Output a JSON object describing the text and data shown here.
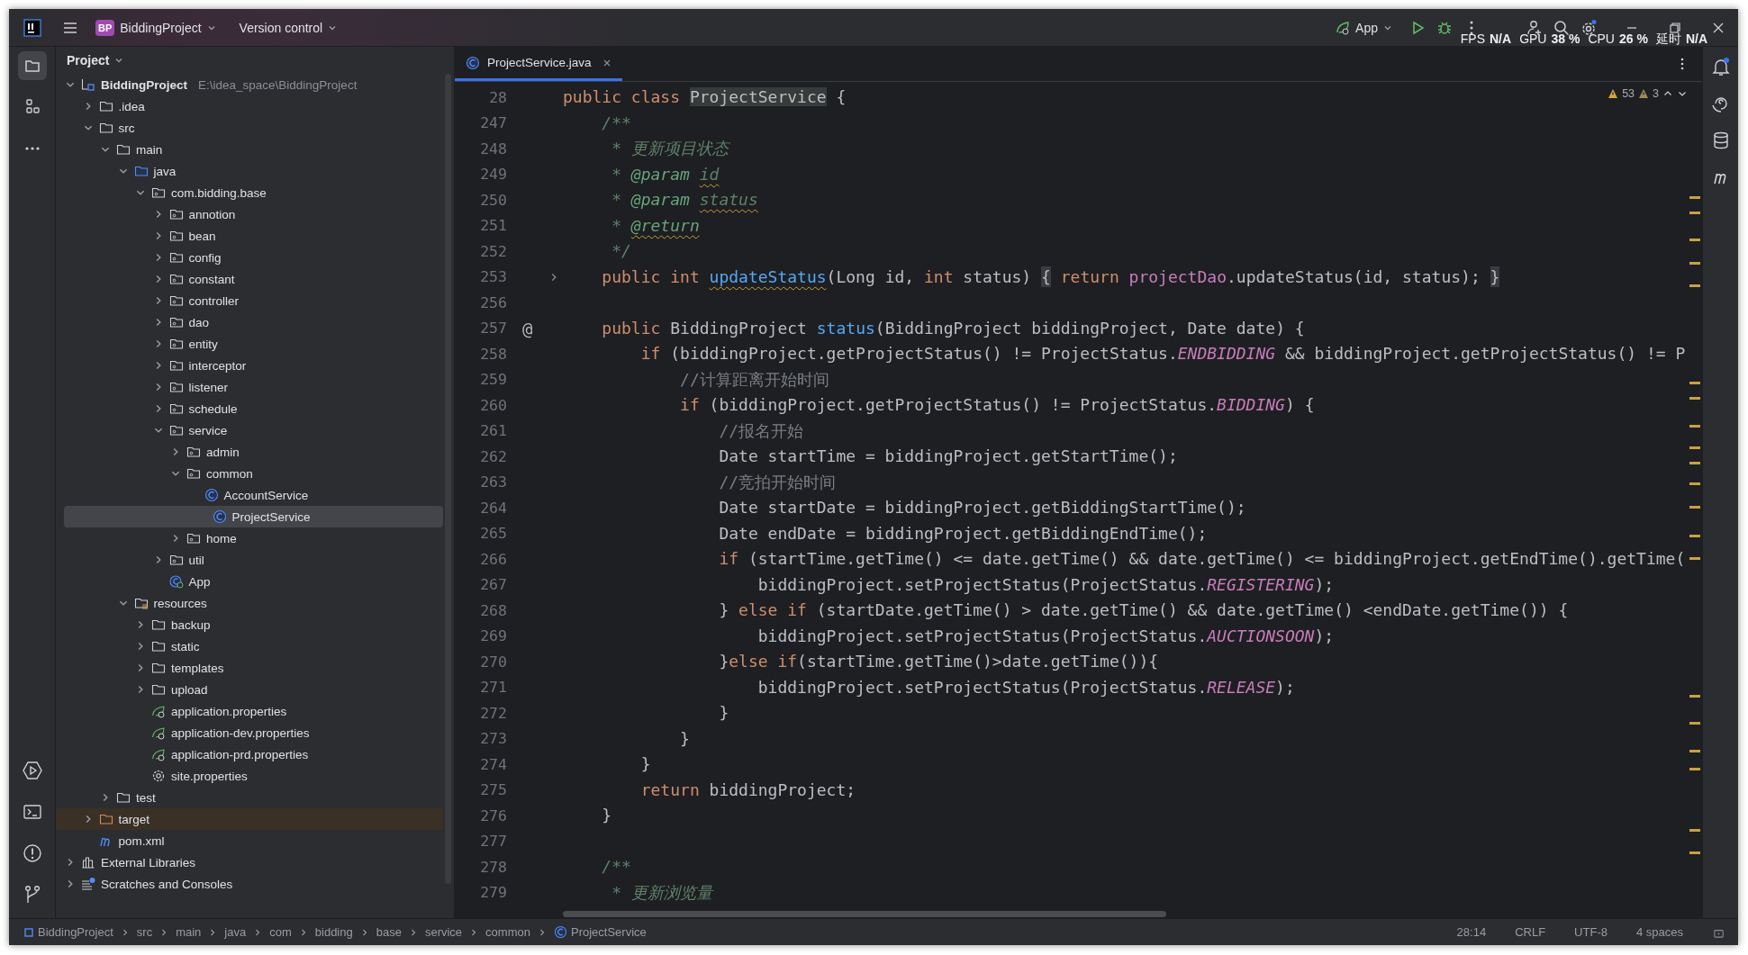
{
  "toolbar": {
    "project_badge": "BP",
    "project": "BiddingProject",
    "vcs": "Version control",
    "run_config": "App"
  },
  "perf_overlay": [
    {
      "label": "FPS",
      "value": "N/A"
    },
    {
      "label": "GPU",
      "value": "38 %"
    },
    {
      "label": "CPU",
      "value": "26 %"
    },
    {
      "label": "延时",
      "value": "N/A"
    }
  ],
  "project_panel": {
    "title": "Project",
    "tree": [
      {
        "label": "BiddingProject",
        "path": "E:\\idea_space\\BiddingProject",
        "kind": "module",
        "expanded": true,
        "selected": false,
        "children": [
          {
            "label": ".idea",
            "kind": "folder",
            "expanded": false,
            "selected": false
          },
          {
            "label": "src",
            "kind": "folder",
            "expanded": true,
            "selected": false,
            "children": [
              {
                "label": "main",
                "kind": "folder",
                "expanded": true,
                "selected": false,
                "children": [
                  {
                    "label": "java",
                    "kind": "source",
                    "expanded": true,
                    "selected": false,
                    "children": [
                      {
                        "label": "com.bidding.base",
                        "kind": "package",
                        "expanded": true,
                        "selected": false,
                        "children": [
                          {
                            "label": "annotion",
                            "kind": "package",
                            "expanded": false,
                            "selected": false
                          },
                          {
                            "label": "bean",
                            "kind": "package",
                            "expanded": false,
                            "selected": false
                          },
                          {
                            "label": "config",
                            "kind": "package",
                            "expanded": false,
                            "selected": false
                          },
                          {
                            "label": "constant",
                            "kind": "package",
                            "expanded": false,
                            "selected": false
                          },
                          {
                            "label": "controller",
                            "kind": "package",
                            "expanded": false,
                            "selected": false
                          },
                          {
                            "label": "dao",
                            "kind": "package",
                            "expanded": false,
                            "selected": false
                          },
                          {
                            "label": "entity",
                            "kind": "package",
                            "expanded": false,
                            "selected": false
                          },
                          {
                            "label": "interceptor",
                            "kind": "package",
                            "expanded": false,
                            "selected": false
                          },
                          {
                            "label": "listener",
                            "kind": "package",
                            "expanded": false,
                            "selected": false
                          },
                          {
                            "label": "schedule",
                            "kind": "package",
                            "expanded": false,
                            "selected": false
                          },
                          {
                            "label": "service",
                            "kind": "package",
                            "expanded": true,
                            "selected": false,
                            "children": [
                              {
                                "label": "admin",
                                "kind": "package",
                                "expanded": false,
                                "selected": false
                              },
                              {
                                "label": "common",
                                "kind": "package",
                                "expanded": true,
                                "selected": false,
                                "children": [
                                  {
                                    "label": "AccountService",
                                    "kind": "class",
                                    "selected": false
                                  },
                                  {
                                    "label": "ProjectService",
                                    "kind": "class",
                                    "selected": true
                                  }
                                ]
                              },
                              {
                                "label": "home",
                                "kind": "package",
                                "expanded": false,
                                "selected": false
                              }
                            ]
                          },
                          {
                            "label": "util",
                            "kind": "package",
                            "expanded": false,
                            "selected": false
                          },
                          {
                            "label": "App",
                            "kind": "springclass",
                            "selected": false
                          }
                        ]
                      }
                    ]
                  },
                  {
                    "label": "resources",
                    "kind": "resources",
                    "expanded": true,
                    "selected": false,
                    "children": [
                      {
                        "label": "backup",
                        "kind": "folder",
                        "expanded": false,
                        "selected": false
                      },
                      {
                        "label": "static",
                        "kind": "folder",
                        "expanded": false,
                        "selected": false
                      },
                      {
                        "label": "templates",
                        "kind": "folder",
                        "expanded": false,
                        "selected": false
                      },
                      {
                        "label": "upload",
                        "kind": "folder",
                        "expanded": false,
                        "selected": false
                      },
                      {
                        "label": "application.properties",
                        "kind": "springprops",
                        "selected": false
                      },
                      {
                        "label": "application-dev.properties",
                        "kind": "springprops",
                        "selected": false
                      },
                      {
                        "label": "application-prd.properties",
                        "kind": "springprops",
                        "selected": false
                      },
                      {
                        "label": "site.properties",
                        "kind": "settings",
                        "selected": false
                      }
                    ]
                  }
                ]
              },
              {
                "label": "test",
                "kind": "folder",
                "expanded": false,
                "selected": false
              }
            ]
          },
          {
            "label": "target",
            "kind": "excluded",
            "expanded": false,
            "selected": false
          },
          {
            "label": "pom.xml",
            "kind": "maven",
            "selected": false
          }
        ]
      },
      {
        "label": "External Libraries",
        "kind": "libraries",
        "expanded": false,
        "selected": false
      },
      {
        "label": "Scratches and Consoles",
        "kind": "scratches",
        "expanded": false,
        "selected": false
      }
    ]
  },
  "editor": {
    "tabs": [
      {
        "label": "ProjectService.java",
        "selected": true
      }
    ],
    "inspections": {
      "warnings": "53",
      "weak_warnings": "3"
    },
    "sticky_line": {
      "number": "28",
      "tokens": [
        {
          "kind": "keyword",
          "text": "public class "
        },
        {
          "kind": "marked",
          "text": "ProjectService"
        },
        {
          "kind": "plain",
          "text": " {"
        }
      ]
    },
    "lines": [
      {
        "number": "247",
        "tokens": [
          {
            "kind": "doc",
            "text": "    /**"
          }
        ]
      },
      {
        "number": "248",
        "tokens": [
          {
            "kind": "doc",
            "text": "     * 更新项目状态"
          }
        ]
      },
      {
        "number": "249",
        "tokens": [
          {
            "kind": "doc",
            "text": "     * "
          },
          {
            "kind": "doctag",
            "text": "@param "
          },
          {
            "kind": "doc",
            "text": "id",
            "flagged": true
          }
        ]
      },
      {
        "number": "250",
        "tokens": [
          {
            "kind": "doc",
            "text": "     * "
          },
          {
            "kind": "doctag",
            "text": "@param "
          },
          {
            "kind": "doc",
            "text": "status",
            "flagged": true
          }
        ]
      },
      {
        "number": "251",
        "tokens": [
          {
            "kind": "doc",
            "text": "     * "
          },
          {
            "kind": "doctag",
            "text": "@return",
            "flagged": true
          }
        ]
      },
      {
        "number": "252",
        "tokens": [
          {
            "kind": "doc",
            "text": "     */"
          }
        ]
      },
      {
        "number": "253",
        "folded": true,
        "tokens": [
          {
            "kind": "keyword",
            "text": "    public int "
          },
          {
            "kind": "method",
            "text": "updateStatus",
            "flagged": true
          },
          {
            "kind": "plain",
            "text": "(Long id, "
          },
          {
            "kind": "keyword",
            "text": "int "
          },
          {
            "kind": "plain",
            "text": "status) "
          },
          {
            "kind": "folded",
            "text": "{"
          },
          {
            "kind": "keyword",
            "text": " return "
          },
          {
            "kind": "field",
            "text": "projectDao"
          },
          {
            "kind": "plain",
            "text": ".updateStatus(id, status); "
          },
          {
            "kind": "folded",
            "text": "}"
          }
        ]
      },
      {
        "number": "256"
      },
      {
        "number": "257",
        "gutter_mark": "@",
        "tokens": [
          {
            "kind": "keyword",
            "text": "    public "
          },
          {
            "kind": "plain",
            "text": "BiddingProject "
          },
          {
            "kind": "method",
            "text": "status"
          },
          {
            "kind": "plain",
            "text": "(BiddingProject biddingProject, Date date) {"
          }
        ]
      },
      {
        "number": "258",
        "tokens": [
          {
            "kind": "keyword",
            "text": "        if "
          },
          {
            "kind": "plain",
            "text": "(biddingProject.getProjectStatus() != ProjectStatus."
          },
          {
            "kind": "constant",
            "text": "ENDBIDDING"
          },
          {
            "kind": "plain",
            "text": " && biddingProject.getProjectStatus() != P"
          }
        ]
      },
      {
        "number": "259",
        "tokens": [
          {
            "kind": "comment",
            "text": "            //计算距离开始时间"
          }
        ]
      },
      {
        "number": "260",
        "tokens": [
          {
            "kind": "keyword",
            "text": "            if "
          },
          {
            "kind": "plain",
            "text": "(biddingProject.getProjectStatus() != ProjectStatus."
          },
          {
            "kind": "constant",
            "text": "BIDDING"
          },
          {
            "kind": "plain",
            "text": ") {"
          }
        ]
      },
      {
        "number": "261",
        "tokens": [
          {
            "kind": "comment",
            "text": "                //报名开始"
          }
        ]
      },
      {
        "number": "262",
        "tokens": [
          {
            "kind": "plain",
            "text": "                Date startTime = biddingProject.getStartTime();"
          }
        ]
      },
      {
        "number": "263",
        "tokens": [
          {
            "kind": "comment",
            "text": "                //竞拍开始时间"
          }
        ]
      },
      {
        "number": "264",
        "tokens": [
          {
            "kind": "plain",
            "text": "                Date startDate = biddingProject.getBiddingStartTime();"
          }
        ]
      },
      {
        "number": "265",
        "tokens": [
          {
            "kind": "plain",
            "text": "                Date endDate = biddingProject.getBiddingEndTime();"
          }
        ]
      },
      {
        "number": "266",
        "tokens": [
          {
            "kind": "keyword",
            "text": "                if "
          },
          {
            "kind": "plain",
            "text": "(startTime.getTime() <= date.getTime() && date.getTime() <= biddingProject.getEndTime().getTime("
          }
        ]
      },
      {
        "number": "267",
        "tokens": [
          {
            "kind": "plain",
            "text": "                    biddingProject.setProjectStatus(ProjectStatus."
          },
          {
            "kind": "constant",
            "text": "REGISTERING"
          },
          {
            "kind": "plain",
            "text": ");"
          }
        ]
      },
      {
        "number": "268",
        "tokens": [
          {
            "kind": "plain",
            "text": "                } "
          },
          {
            "kind": "keyword",
            "text": "else if "
          },
          {
            "kind": "plain",
            "text": "(startDate.getTime() > date.getTime() && date.getTime() <endDate.getTime()) {"
          }
        ]
      },
      {
        "number": "269",
        "tokens": [
          {
            "kind": "plain",
            "text": "                    biddingProject.setProjectStatus(ProjectStatus."
          },
          {
            "kind": "constant",
            "text": "AUCTIONSOON"
          },
          {
            "kind": "plain",
            "text": ");"
          }
        ]
      },
      {
        "number": "270",
        "tokens": [
          {
            "kind": "plain",
            "text": "                }"
          },
          {
            "kind": "keyword",
            "text": "else if"
          },
          {
            "kind": "plain",
            "text": "(startTime.getTime()>date.getTime()){"
          }
        ]
      },
      {
        "number": "271",
        "tokens": [
          {
            "kind": "plain",
            "text": "                    biddingProject.setProjectStatus(ProjectStatus."
          },
          {
            "kind": "constant",
            "text": "RELEASE"
          },
          {
            "kind": "plain",
            "text": ");"
          }
        ]
      },
      {
        "number": "272",
        "tokens": [
          {
            "kind": "plain",
            "text": "                }"
          }
        ]
      },
      {
        "number": "273",
        "tokens": [
          {
            "kind": "plain",
            "text": "            }"
          }
        ]
      },
      {
        "number": "274",
        "tokens": [
          {
            "kind": "plain",
            "text": "        }"
          }
        ]
      },
      {
        "number": "275",
        "tokens": [
          {
            "kind": "keyword",
            "text": "        return "
          },
          {
            "kind": "plain",
            "text": "biddingProject;"
          }
        ]
      },
      {
        "number": "276",
        "tokens": [
          {
            "kind": "plain",
            "text": "    }"
          }
        ]
      },
      {
        "number": "277"
      },
      {
        "number": "278",
        "tokens": [
          {
            "kind": "doc",
            "text": "    /**"
          }
        ]
      },
      {
        "number": "279",
        "tokens": [
          {
            "kind": "doc",
            "text": "     * 更新浏览量"
          }
        ]
      }
    ]
  },
  "breadcrumbs": [
    {
      "label": "BiddingProject",
      "kind": "module"
    },
    {
      "label": "src"
    },
    {
      "label": "main"
    },
    {
      "label": "java"
    },
    {
      "label": "com"
    },
    {
      "label": "bidding"
    },
    {
      "label": "base"
    },
    {
      "label": "service"
    },
    {
      "label": "common"
    },
    {
      "label": "ProjectService",
      "kind": "class"
    }
  ],
  "status": {
    "position": "28:14",
    "line_separator": "CRLF",
    "encoding": "UTF-8",
    "indent": "4 spaces"
  }
}
